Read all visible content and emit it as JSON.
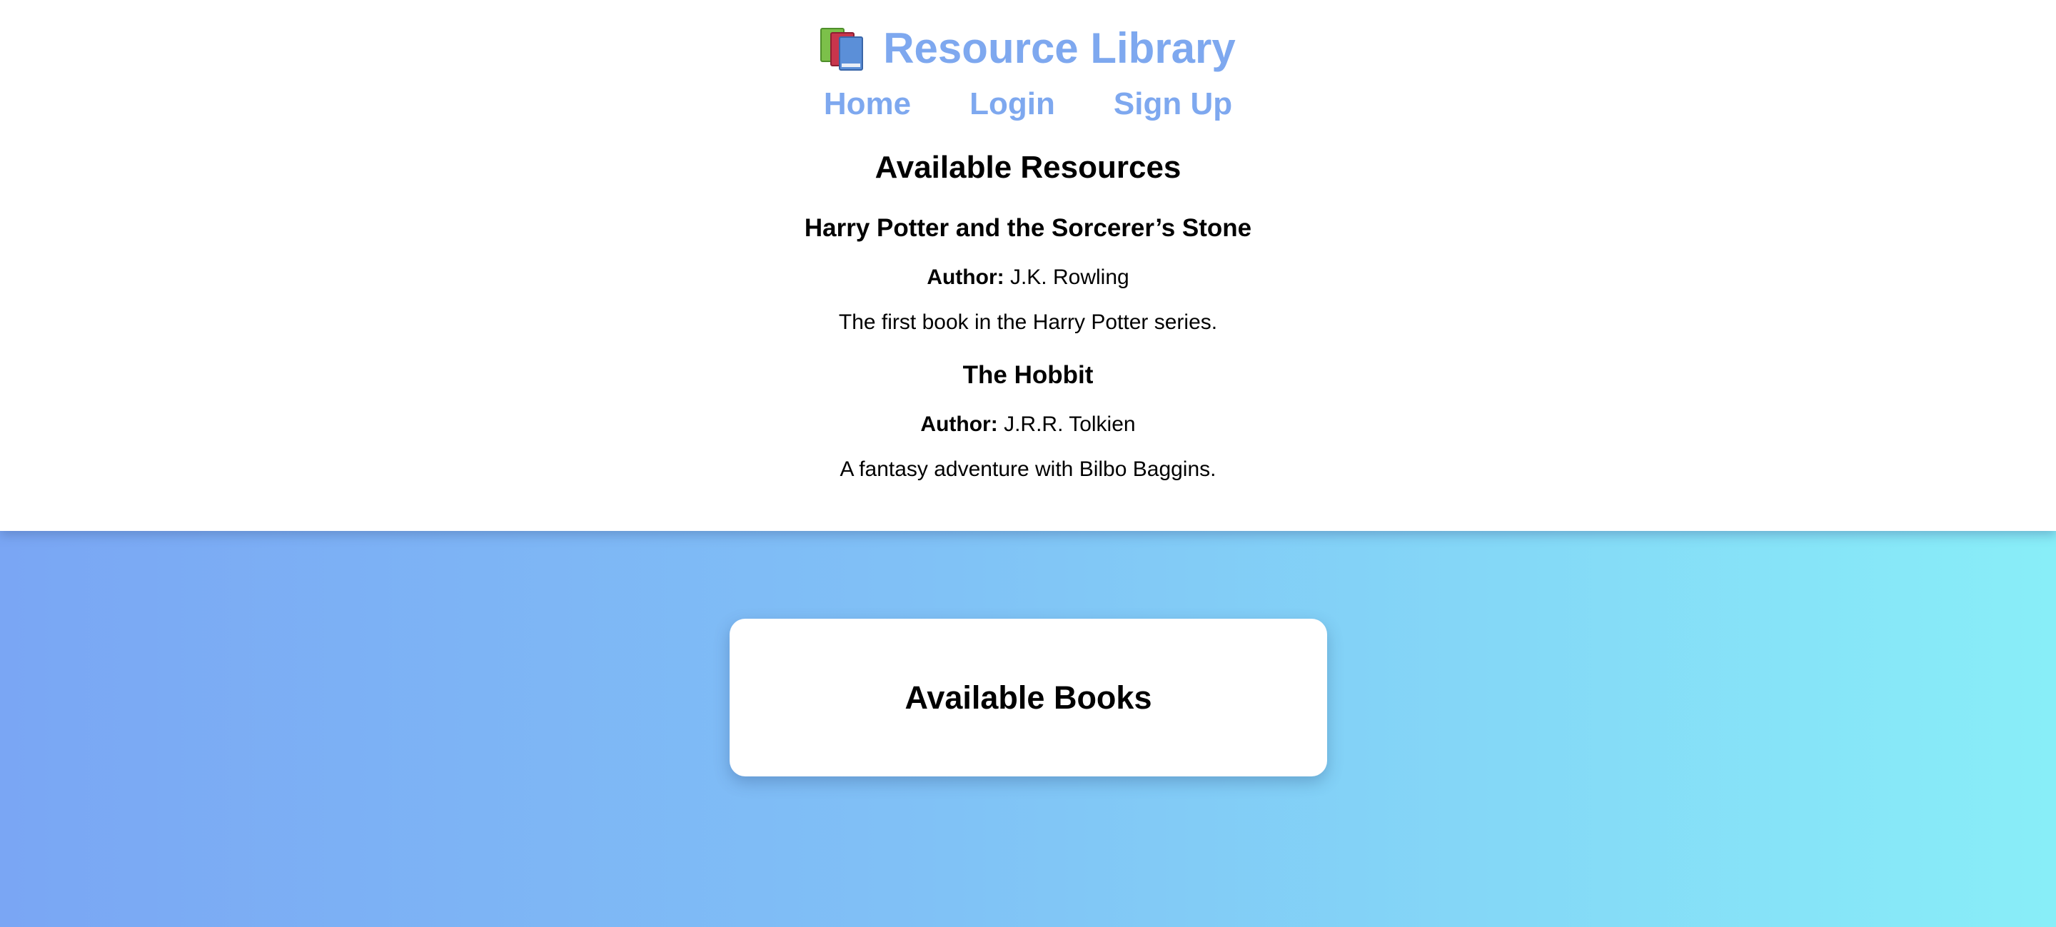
{
  "header": {
    "icon": "books-icon",
    "title": "Resource Library"
  },
  "nav": {
    "items": [
      {
        "label": "Home"
      },
      {
        "label": "Login"
      },
      {
        "label": "Sign Up"
      }
    ]
  },
  "resources": {
    "heading": "Available Resources",
    "author_label": "Author:",
    "books": [
      {
        "title": "Harry Potter and the Sorcerer’s Stone",
        "author": "J.K. Rowling",
        "description": "The first book in the Harry Potter series."
      },
      {
        "title": "The Hobbit",
        "author": "J.R.R. Tolkien",
        "description": "A fantasy adventure with Bilbo Baggins."
      }
    ]
  },
  "books_card": {
    "heading": "Available Books"
  },
  "colors": {
    "brand": "#7ea8ef",
    "gradient_start": "#7aa6f4",
    "gradient_end": "#88eef8"
  }
}
